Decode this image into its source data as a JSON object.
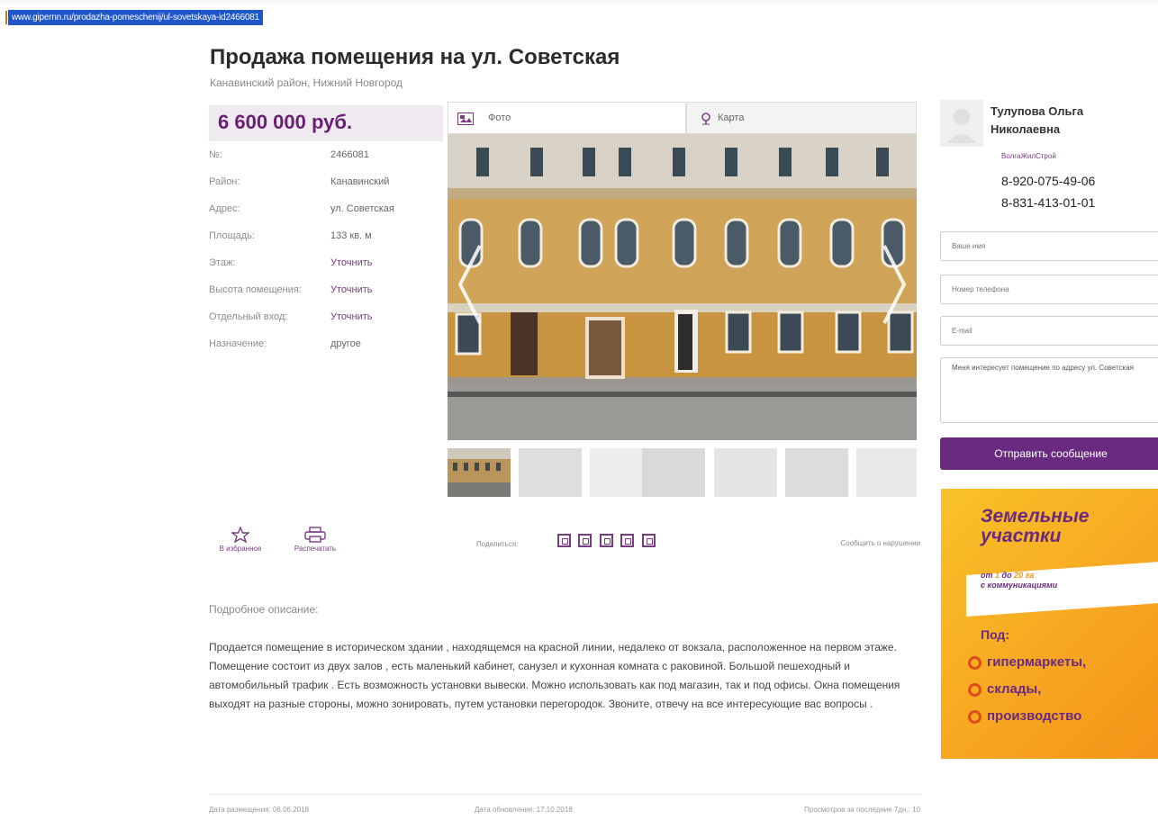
{
  "url_bar": {
    "url": "www.gipernn.ru/prodazha-pomeschenij/ul-sovetskaya-id2466081"
  },
  "listing": {
    "title": "Продажа помещения на ул. Советская",
    "subtitle": "Канавинский район, Нижний Новгород",
    "price": "6 600 000 руб.",
    "properties": [
      {
        "label": "№:",
        "value": "2466081"
      },
      {
        "label": "Район:",
        "value": "Канавинский"
      },
      {
        "label": "Адрес:",
        "value": "ул. Советская"
      },
      {
        "label": "Площадь:",
        "value": "133 кв. м"
      },
      {
        "label": "Этаж:",
        "value": "Уточнить"
      },
      {
        "label": "Высота помещения:",
        "value": "Уточнить"
      },
      {
        "label": "Отдельный вход:",
        "value": "Уточнить"
      },
      {
        "label": "Назначение:",
        "value": "другое"
      }
    ]
  },
  "gallery": {
    "tabs": [
      {
        "label": "Фото",
        "icon": "photo-icon"
      },
      {
        "label": "Карта",
        "icon": "map-pin-icon"
      }
    ],
    "thumbnail_count": 7
  },
  "actions": {
    "favorite_label": "В избранное",
    "print_label": "Распечатать",
    "share_label": "Поделиться:",
    "report_label": "Сообщить о нарушении"
  },
  "description": {
    "title": "Подробное описание:",
    "text": "Продается помещение в историческом здании , находящемся на красной линии, недалеко от вокзала, расположенное на первом этаже. Помещение состоит из двух залов , есть маленький кабинет, санузел и кухонная комната с раковиной. Большой пешеходный и автомобильный трафик . Есть возможность установки вывески. Можно использовать как под магазин, так и под офисы. Окна помещения выходят на разные стороны, можно зонировать, путем установки перегородок. Звоните, отвечу на все интересующие вас вопросы ."
  },
  "meta": {
    "posted": "Дата размещения: 06.06.2018",
    "updated": "Дата обновления: 17.10.2018",
    "views": "Просмотров за последние 7дн.: 10"
  },
  "agent": {
    "name": "Тулупова Ольга Николаевна",
    "company": "ВолгаЖилСтрой",
    "phones": [
      "8-920-075-49-06",
      "8-831-413-01-01"
    ]
  },
  "contact_form": {
    "name_placeholder": "Ваше имя",
    "phone_placeholder": "Номер телефона",
    "email_placeholder": "E-mail",
    "message_value": "Меня интересует помещение по адресу ул. Советская",
    "submit_label": "Отправить сообщение"
  },
  "ad": {
    "title_line1": "Земельные",
    "title_line2": "участки",
    "sub_prefix": "от",
    "sub_from": "1",
    "sub_mid": "до",
    "sub_to": "20",
    "sub_unit": "га",
    "sub_line2": "с коммуникациями",
    "under": "Под:",
    "items": [
      "гипермаркеты,",
      "склады,",
      "производство"
    ]
  },
  "colors": {
    "brand_purple": "#6a2a80",
    "price_bg": "#eeeaf0",
    "ad_orange": "#f7a520"
  }
}
